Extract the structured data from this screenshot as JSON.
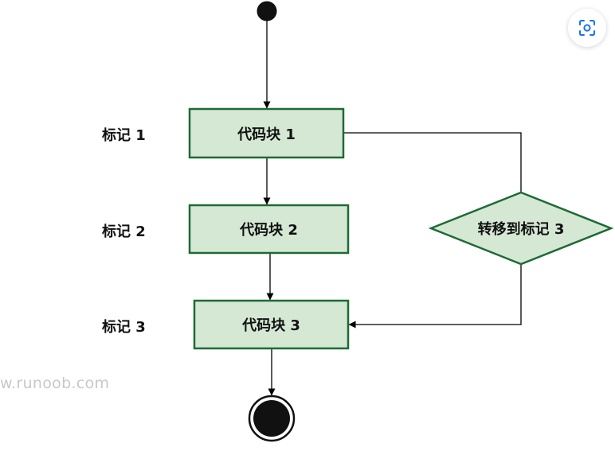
{
  "diagram": {
    "markers": [
      "标记 1",
      "标记 2",
      "标记 3"
    ],
    "blocks": [
      "代码块 1",
      "代码块 2",
      "代码块 3"
    ],
    "decision": "转移到标记 3"
  },
  "watermark": "w.runoob.com",
  "colors": {
    "node_fill": "#d5e8d4",
    "node_stroke": "#1d6b35",
    "edge": "#000000",
    "lens_icon": "#1a73e8"
  },
  "icons": {
    "lens": "visual-search-icon"
  }
}
